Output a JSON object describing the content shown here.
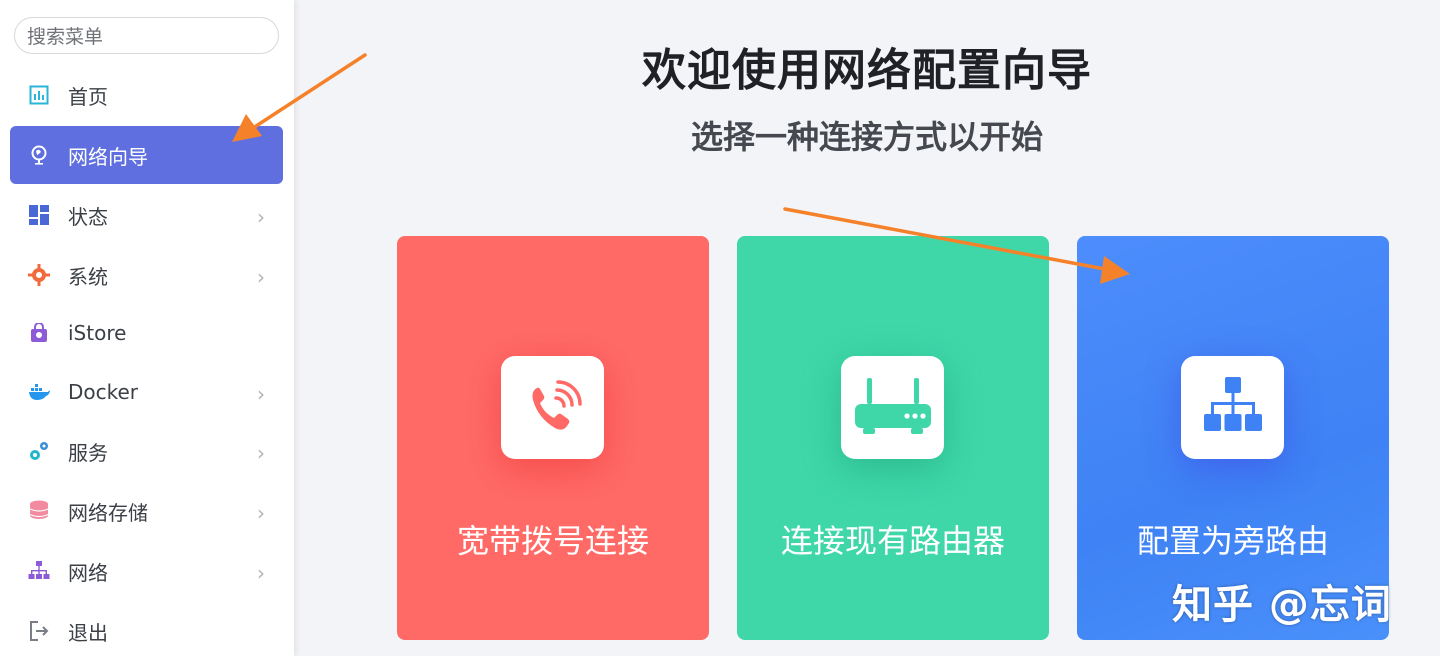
{
  "search": {
    "placeholder": "搜索菜单"
  },
  "sidebar": {
    "items": [
      {
        "label": "首页",
        "icon": "dashboard-icon",
        "color": "#29b6d6",
        "chevron": false,
        "active": false
      },
      {
        "label": "网络向导",
        "icon": "globe-icon",
        "color": "#ffffff",
        "chevron": false,
        "active": true
      },
      {
        "label": "状态",
        "icon": "grid-icon",
        "color": "#4a67d6",
        "chevron": true,
        "active": false
      },
      {
        "label": "系统",
        "icon": "gear-icon",
        "color": "#f06a3b",
        "chevron": true,
        "active": false
      },
      {
        "label": "iStore",
        "icon": "bag-icon",
        "color": "#8e5bd6",
        "chevron": false,
        "active": false
      },
      {
        "label": "Docker",
        "icon": "docker-icon",
        "color": "#2496ed",
        "chevron": true,
        "active": false
      },
      {
        "label": "服务",
        "icon": "gears-icon",
        "color": "#23b6c8",
        "chevron": true,
        "active": false
      },
      {
        "label": "网络存储",
        "icon": "database-icon",
        "color": "#f28aa0",
        "chevron": true,
        "active": false
      },
      {
        "label": "网络",
        "icon": "network-icon",
        "color": "#8e5bd6",
        "chevron": true,
        "active": false
      },
      {
        "label": "退出",
        "icon": "logout-icon",
        "color": "#7a7e86",
        "chevron": false,
        "active": false
      }
    ]
  },
  "main": {
    "title": "欢迎使用网络配置向导",
    "subtitle": "选择一种连接方式以开始",
    "cards": [
      {
        "label": "宽带拨号连接",
        "icon": "phone-icon",
        "color": "#ff6a67"
      },
      {
        "label": "连接现有路由器",
        "icon": "router-icon",
        "color": "#3fd7a8"
      },
      {
        "label": "配置为旁路由",
        "icon": "network-tree-icon",
        "color": "#4289f8"
      }
    ]
  },
  "watermark": "知乎 @忘词",
  "colors": {
    "accent": "#5f6fe0",
    "arrow": "#f5822a"
  }
}
